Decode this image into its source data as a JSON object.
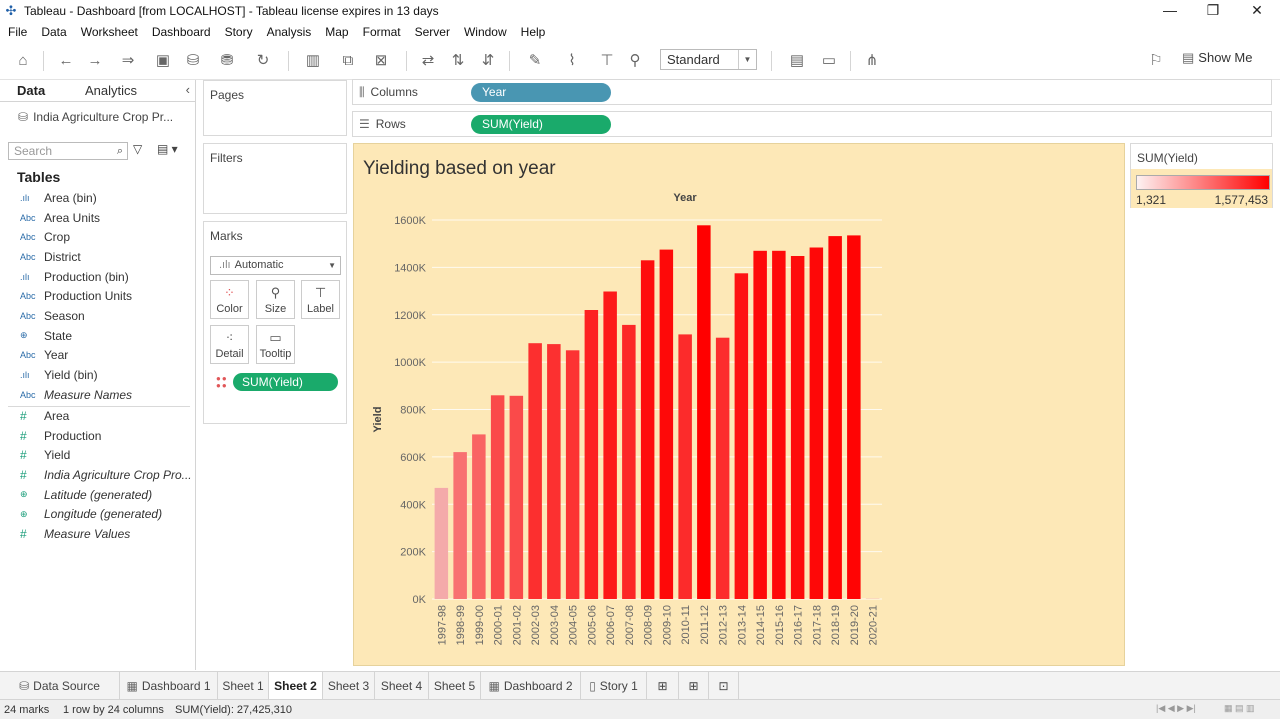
{
  "window": {
    "title": "Tableau - Dashboard [from LOCALHOST] - Tableau license expires in 13 days",
    "minimize": "—",
    "restore": "❐",
    "close": "✕"
  },
  "menu": [
    "File",
    "Data",
    "Worksheet",
    "Dashboard",
    "Story",
    "Analysis",
    "Map",
    "Format",
    "Server",
    "Window",
    "Help"
  ],
  "toolbar": {
    "fit": "Standard",
    "show_me": "Show Me"
  },
  "data_pane": {
    "tab_data": "Data",
    "tab_analytics": "Analytics",
    "datasource": "India Agriculture Crop Pr...",
    "search_placeholder": "Search",
    "tables_label": "Tables",
    "dimensions": [
      {
        "type": ".ılı",
        "name": "Area (bin)",
        "italic": false
      },
      {
        "type": "Abc",
        "name": "Area Units",
        "italic": false
      },
      {
        "type": "Abc",
        "name": "Crop",
        "italic": false
      },
      {
        "type": "Abc",
        "name": "District",
        "italic": false
      },
      {
        "type": ".ılı",
        "name": "Production (bin)",
        "italic": false
      },
      {
        "type": "Abc",
        "name": "Production Units",
        "italic": false
      },
      {
        "type": "Abc",
        "name": "Season",
        "italic": false
      },
      {
        "type": "⊕",
        "name": "State",
        "italic": false
      },
      {
        "type": "Abc",
        "name": "Year",
        "italic": false
      },
      {
        "type": ".ılı",
        "name": "Yield (bin)",
        "italic": false
      },
      {
        "type": "Abc",
        "name": "Measure Names",
        "italic": true
      }
    ],
    "measures": [
      {
        "type": "#",
        "name": "Area",
        "italic": false
      },
      {
        "type": "#",
        "name": "Production",
        "italic": false
      },
      {
        "type": "#",
        "name": "Yield",
        "italic": false
      },
      {
        "type": "#",
        "name": "India Agriculture Crop Pro...",
        "italic": true
      },
      {
        "type": "⊕",
        "name": "Latitude (generated)",
        "italic": true
      },
      {
        "type": "⊕",
        "name": "Longitude (generated)",
        "italic": true
      },
      {
        "type": "#",
        "name": "Measure Values",
        "italic": true
      }
    ]
  },
  "cards": {
    "pages": "Pages",
    "filters": "Filters",
    "marks": "Marks",
    "mark_type": "Automatic",
    "mark_buttons": [
      "Color",
      "Size",
      "Label",
      "Detail",
      "Tooltip"
    ],
    "marks_pill": "SUM(Yield)"
  },
  "shelves": {
    "columns_label": "Columns",
    "columns_pill": "Year",
    "rows_label": "Rows",
    "rows_pill": "SUM(Yield)"
  },
  "legend": {
    "title": "SUM(Yield)",
    "min": "1,321",
    "max": "1,577,453"
  },
  "chart_data": {
    "type": "bar",
    "title": "Yielding based on year",
    "xlabel": "Year",
    "ylabel": "Yield",
    "ylim": [
      0,
      1600000
    ],
    "y_ticks": [
      0,
      200000,
      400000,
      600000,
      800000,
      1000000,
      1200000,
      1400000,
      1600000
    ],
    "y_tick_labels": [
      "0K",
      "200K",
      "400K",
      "600K",
      "800K",
      "1000K",
      "1200K",
      "1400K",
      "1600K"
    ],
    "color_range": [
      "#f4aaaa",
      "#ff0000"
    ],
    "categories": [
      "1997-98",
      "1998-99",
      "1999-00",
      "2000-01",
      "2001-02",
      "2002-03",
      "2003-04",
      "2004-05",
      "2005-06",
      "2006-07",
      "2007-08",
      "2008-09",
      "2009-10",
      "2010-11",
      "2011-12",
      "2012-13",
      "2013-14",
      "2014-15",
      "2015-16",
      "2016-17",
      "2017-18",
      "2018-19",
      "2019-20",
      "2020-21"
    ],
    "values": [
      469000,
      620000,
      695000,
      860000,
      858000,
      1080000,
      1076000,
      1050000,
      1220000,
      1298000,
      1157000,
      1430000,
      1475000,
      1117000,
      1577453,
      1103000,
      1375000,
      1470000,
      1470000,
      1448000,
      1484000,
      1532000,
      1535000,
      1321
    ]
  },
  "sheet_tabs": [
    {
      "icon": "⛁",
      "label": "Data Source"
    },
    {
      "icon": "▦",
      "label": "Dashboard 1"
    },
    {
      "icon": "",
      "label": "Sheet 1"
    },
    {
      "icon": "",
      "label": "Sheet 2"
    },
    {
      "icon": "",
      "label": "Sheet 3"
    },
    {
      "icon": "",
      "label": "Sheet 4"
    },
    {
      "icon": "",
      "label": "Sheet 5"
    },
    {
      "icon": "▦",
      "label": "Dashboard 2"
    },
    {
      "icon": "▯",
      "label": "Story 1"
    }
  ],
  "status": {
    "marks": "24 marks",
    "dims": "1 row by 24 columns",
    "sum": "SUM(Yield): 27,425,310"
  }
}
